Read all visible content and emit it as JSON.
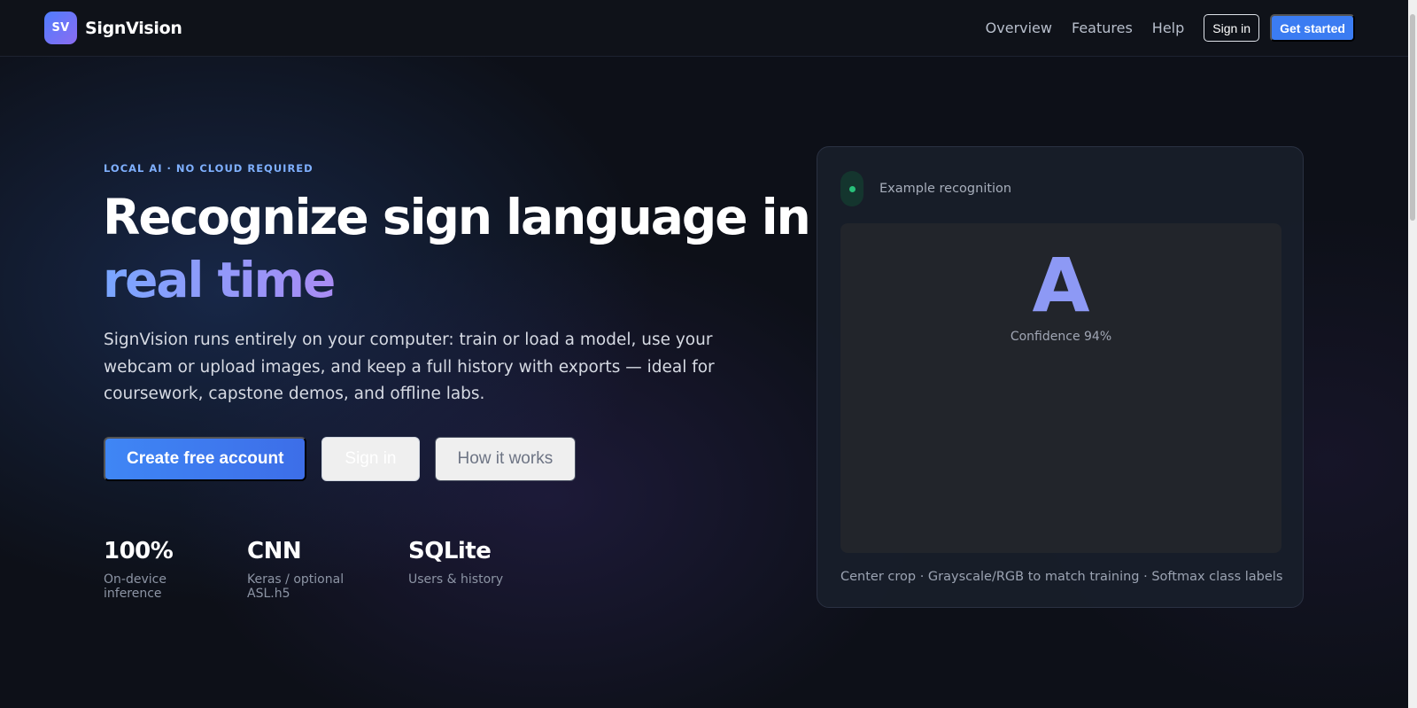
{
  "brand": {
    "logo_text": "SV",
    "name": "SignVision"
  },
  "nav": {
    "links": [
      "Overview",
      "Features",
      "Help"
    ],
    "sign_in": "Sign in",
    "get_started": "Get started"
  },
  "hero": {
    "eyebrow": "LOCAL AI · NO CLOUD REQUIRED",
    "headline_main": "Recognize sign language in ",
    "headline_accent": "real time",
    "lede": "SignVision runs entirely on your computer: train or load a model, use your webcam or upload images, and keep a full history with exports — ideal for coursework, capstone demos, and offline labs.",
    "cta_primary": "Create free account",
    "cta_signin": "Sign in",
    "cta_how": "How it works",
    "stats": [
      {
        "value": "100%",
        "label": "On-device inference"
      },
      {
        "value": "CNN",
        "label": "Keras / optional ASL.h5"
      },
      {
        "value": "SQLite",
        "label": "Users & history"
      }
    ]
  },
  "card": {
    "title": "Example recognition",
    "letter": "A",
    "confidence": "Confidence 94%",
    "footer": "Center crop · Grayscale/RGB to match training · Softmax class labels"
  },
  "colors": {
    "accent": "#3b7cf2",
    "gradient_start": "#79a6ff",
    "gradient_end": "#a98cf4",
    "status": "#28c07a"
  }
}
